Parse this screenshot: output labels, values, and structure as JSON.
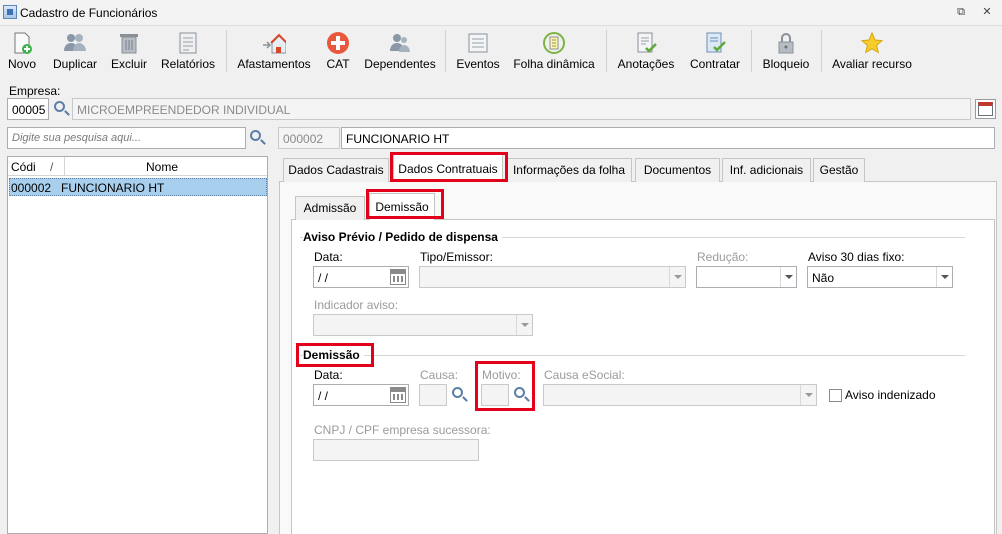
{
  "window": {
    "title": "Cadastro de Funcionários"
  },
  "toolbar": {
    "novo": "Novo",
    "duplicar": "Duplicar",
    "excluir": "Excluir",
    "relatorios": "Relatórios",
    "afastamentos": "Afastamentos",
    "cat": "CAT",
    "dependentes": "Dependentes",
    "eventos": "Eventos",
    "folha_dinamica": "Folha dinâmica",
    "anotacoes": "Anotações",
    "contratar": "Contratar",
    "bloqueio": "Bloqueio",
    "avaliar_recurso": "Avaliar recurso"
  },
  "empresa": {
    "label": "Empresa:",
    "code": "00005",
    "name": "MICROEMPREENDEDOR INDIVIDUAL"
  },
  "search": {
    "placeholder": "Digite sua pesquisa aqui..."
  },
  "employee": {
    "code": "000002",
    "name": "FUNCIONARIO HT"
  },
  "list": {
    "col_code": "Códi",
    "sort_indicator": "/",
    "col_name": "Nome",
    "rows": [
      {
        "code": "000002",
        "name": "FUNCIONARIO HT"
      }
    ]
  },
  "tabs": {
    "dados_cadastrais": "Dados Cadastrais",
    "dados_contratuais": "Dados Contratuais",
    "informacoes_folha": "Informações da folha",
    "documentos": "Documentos",
    "inf_adicionais": "Inf. adicionais",
    "gestao": "Gestão"
  },
  "subtabs": {
    "admissao": "Admissão",
    "demissao": "Demissão"
  },
  "aviso": {
    "section": "Aviso Prévio / Pedido de dispensa",
    "data_label": "Data:",
    "data_value": " /  /",
    "tipo_label": "Tipo/Emissor:",
    "reducao_label": "Redução:",
    "aviso30_label": "Aviso 30 dias fixo:",
    "aviso30_value": "Não",
    "indicador_label": "Indicador aviso:"
  },
  "demissao": {
    "section": "Demissão",
    "data_label": "Data:",
    "data_value": " /  /",
    "causa_label": "Causa:",
    "motivo_label": "Motivo:",
    "causa_esocial_label": "Causa eSocial:",
    "aviso_indenizado": "Aviso indenizado",
    "cnpj_label": "CNPJ / CPF empresa sucessora:"
  },
  "colors": {
    "highlight": "#e3001b",
    "selection": "#a8d0ee"
  }
}
